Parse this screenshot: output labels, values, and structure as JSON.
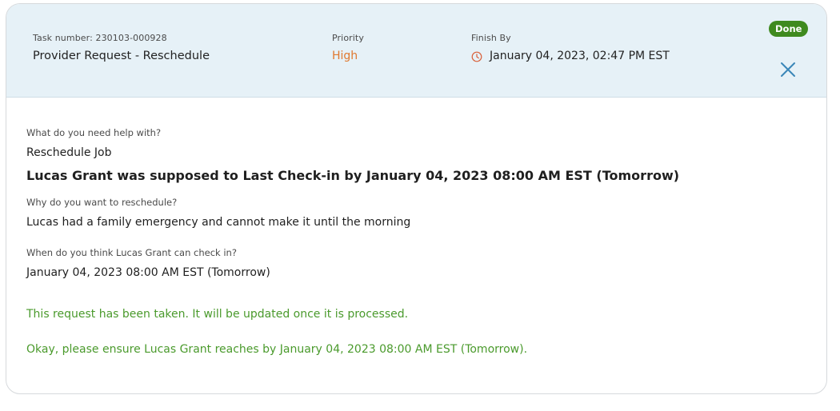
{
  "header": {
    "task_number_label": "Task number: 230103-000928",
    "task_title": "Provider Request - Reschedule",
    "priority_label": "Priority",
    "priority_value": "High",
    "finish_label": "Finish By",
    "finish_value": "January 04, 2023, 02:47 PM EST",
    "status_badge": "Done",
    "close_icon": "close-icon",
    "clock_icon": "clock-icon"
  },
  "details": {
    "q1_label": "What do you need help with?",
    "q1_value": "Reschedule Job",
    "statement": "Lucas Grant was supposed to Last Check-in by January 04, 2023 08:00 AM EST  (Tomorrow)",
    "q2_label": "Why do you want to reschedule?",
    "q2_value": "Lucas had a family emergency and cannot make it until the morning",
    "q3_label": "When do you think Lucas Grant can check in?",
    "q3_value": "January 04, 2023 08:00 AM EST (Tomorrow)"
  },
  "messages": {
    "taken": "This request has been taken. It will be updated once it is processed.",
    "confirm": "Okay, please ensure Lucas Grant reaches by January 04, 2023 08:00 AM EST (Tomorrow)."
  },
  "colors": {
    "header_bg": "#e6f1f7",
    "priority_high": "#e0782e",
    "badge_done": "#3f8a1f",
    "message_green": "#4a9a2c",
    "close_icon": "#3a86b8"
  }
}
